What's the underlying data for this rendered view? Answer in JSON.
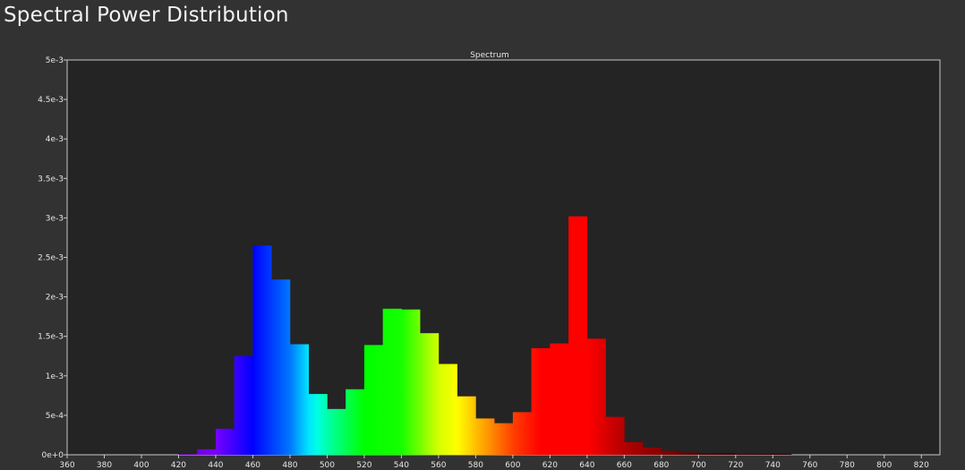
{
  "page": {
    "title": "Spectral Power Distribution"
  },
  "chart_data": {
    "type": "bar",
    "title": "Spectrum",
    "xlabel": "",
    "ylabel": "",
    "xlim": [
      360,
      830
    ],
    "ylim": [
      0,
      0.005
    ],
    "x_ticks": [
      360,
      380,
      400,
      420,
      440,
      460,
      480,
      500,
      520,
      540,
      560,
      580,
      600,
      620,
      640,
      660,
      680,
      700,
      720,
      740,
      760,
      780,
      800,
      820
    ],
    "x_tick_labels": [
      "360",
      "380",
      "400",
      "420",
      "440",
      "460",
      "480",
      "500",
      "520",
      "540",
      "560",
      "580",
      "600",
      "620",
      "640",
      "660",
      "680",
      "700",
      "720",
      "740",
      "760",
      "780",
      "800",
      "820"
    ],
    "y_ticks": [
      0,
      0.0005,
      0.001,
      0.0015,
      0.002,
      0.0025,
      0.003,
      0.0035,
      0.004,
      0.0045,
      0.005
    ],
    "y_tick_labels": [
      "0e+0",
      "5e-4",
      "1e-3",
      "1.5e-3",
      "2e-3",
      "2.5e-3",
      "3e-3",
      "3.5e-3",
      "4e-3",
      "4.5e-3",
      "5e-3"
    ],
    "bin_width": 10,
    "grid": false,
    "legend": "none",
    "colors": {
      "background": "#323232",
      "plot_area": "#242424",
      "axis": "#c8c8c8",
      "text": "#e6e6e6"
    },
    "bins": [
      {
        "x": 420,
        "value": 1e-05
      },
      {
        "x": 430,
        "value": 7e-05
      },
      {
        "x": 440,
        "value": 0.00033
      },
      {
        "x": 450,
        "value": 0.00125
      },
      {
        "x": 460,
        "value": 0.00265
      },
      {
        "x": 470,
        "value": 0.00222
      },
      {
        "x": 480,
        "value": 0.0014
      },
      {
        "x": 490,
        "value": 0.00077
      },
      {
        "x": 500,
        "value": 0.00058
      },
      {
        "x": 510,
        "value": 0.00083
      },
      {
        "x": 520,
        "value": 0.00139
      },
      {
        "x": 530,
        "value": 0.00185
      },
      {
        "x": 540,
        "value": 0.00184
      },
      {
        "x": 550,
        "value": 0.00154
      },
      {
        "x": 560,
        "value": 0.00115
      },
      {
        "x": 570,
        "value": 0.00074
      },
      {
        "x": 580,
        "value": 0.00046
      },
      {
        "x": 590,
        "value": 0.0004
      },
      {
        "x": 600,
        "value": 0.00054
      },
      {
        "x": 610,
        "value": 0.00135
      },
      {
        "x": 620,
        "value": 0.00141
      },
      {
        "x": 630,
        "value": 0.00302
      },
      {
        "x": 640,
        "value": 0.00147
      },
      {
        "x": 650,
        "value": 0.00048
      },
      {
        "x": 660,
        "value": 0.00016
      },
      {
        "x": 670,
        "value": 9e-05
      },
      {
        "x": 680,
        "value": 5e-05
      },
      {
        "x": 690,
        "value": 3e-05
      },
      {
        "x": 700,
        "value": 2e-05
      },
      {
        "x": 710,
        "value": 2e-05
      },
      {
        "x": 720,
        "value": 1e-05
      },
      {
        "x": 730,
        "value": 1e-05
      },
      {
        "x": 740,
        "value": 1e-05
      }
    ]
  }
}
